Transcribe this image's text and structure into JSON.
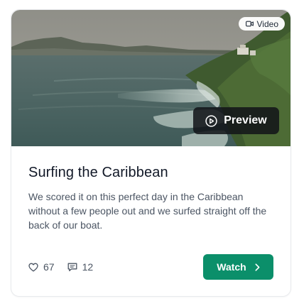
{
  "card": {
    "badge_label": "Video",
    "badge_icon": "video-camera-icon",
    "preview_label": "Preview",
    "preview_icon": "play-circle-icon",
    "title": "Surfing the Caribbean",
    "description": "We scored it on this perfect day in the Caribbean without a few people out and we surfed straight off the back of our boat.",
    "likes": "67",
    "likes_icon": "heart-icon",
    "comments": "12",
    "comments_icon": "comment-icon",
    "watch_label": "Watch",
    "watch_icon": "chevron-right-icon",
    "accent_color": "#0b8f6a"
  }
}
